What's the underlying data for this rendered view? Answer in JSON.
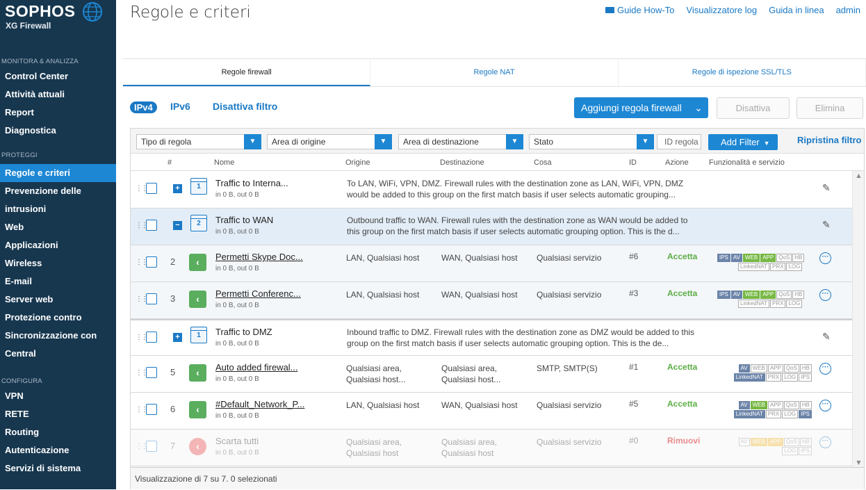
{
  "sidebar": {
    "brand": "SOPHOS",
    "product": "XG Firewall",
    "sections": [
      {
        "label": "MONITORA & ANALIZZA",
        "items": [
          "Control Center",
          "Attività attuali",
          "Report",
          "Diagnostica"
        ]
      },
      {
        "label": "PROTEGGI",
        "items": [
          "Regole e criteri",
          "Prevenzione delle",
          "intrusioni",
          "Web",
          "Applicazioni",
          "Wireless",
          "E-mail",
          "Server web",
          "Protezione contro",
          "Sincronizzazione con",
          "Central"
        ]
      },
      {
        "label": "CONFIGURA",
        "items": [
          "VPN",
          "RETE",
          "Routing",
          "Autenticazione",
          "Servizi di sistema"
        ]
      }
    ],
    "active_item": "Regole e criteri"
  },
  "header": {
    "title": "Regole e criteri",
    "links": {
      "guide": "Guide How-To",
      "log": "Visualizzatore log",
      "help": "Guida in linea",
      "user": "admin"
    }
  },
  "tabs": [
    "Regole firewall",
    "Regole NAT",
    "Regole di ispezione SSL/TLS"
  ],
  "active_tab": "Regole firewall",
  "toolbar": {
    "ipv4": "IPv4",
    "ipv6": "IPv6",
    "disable_filter": "Disattiva filtro",
    "add_rule": "Aggiungi regola firewall",
    "disable": "Disattiva",
    "delete": "Elimina"
  },
  "filters": {
    "rule_type": "Tipo di regola",
    "source_zone": "Area di origine",
    "dest_zone": "Area di destinazione",
    "status": "Stato",
    "rule_id_placeholder": "ID regola",
    "add_filter": "Add Filter",
    "reset": "Ripristina filtro"
  },
  "columns": [
    "#",
    "Nome",
    "Origine",
    "Destinazione",
    "Cosa",
    "ID",
    "Azione",
    "Funzionalità e servizio"
  ],
  "rows": [
    {
      "kind": "group",
      "number": "1",
      "name": "Traffic to Interna...",
      "traffic": "in 0 B, out 0 B",
      "description": "To LAN, WiFi, VPN, DMZ. Firewall rules with the destination zone as LAN, WiFi, VPN, DMZ would be added to this group on the first match basis if user selects automatic grouping..."
    },
    {
      "kind": "group",
      "number": "2",
      "name": "Traffic to WAN",
      "traffic": "in 0 B, out 0 B",
      "description": "Outbound traffic to WAN. Firewall rules with the destination zone as WAN would be added to this group on the first match basis if user selects automatic grouping option. This is the d..."
    },
    {
      "kind": "rule",
      "number": "2",
      "name": "Permetti Skype Doc...",
      "traffic": "in 0 B, out 0 B",
      "source": "LAN, Qualsiasi host",
      "destination": "WAN, Qualsiasi host",
      "what": "Qualsiasi servizio",
      "id": "#6",
      "action": "Accetta"
    },
    {
      "kind": "rule",
      "number": "3",
      "name": "Permetti Conferenc...",
      "traffic": "in 0 B, out 0 B",
      "source": "LAN, Qualsiasi host",
      "destination": "WAN, Qualsiasi host",
      "what": "Qualsiasi servizio",
      "id": "#3",
      "action": "Accetta"
    },
    {
      "kind": "group",
      "number": "1",
      "name": "Traffic to DMZ",
      "traffic": "in 0 B, out 0 B",
      "description": "Inbound traffic to DMZ. Firewall rules with the destination zone as DMZ would be added to this group on the first match basis if user selects automatic grouping option. This is the de..."
    },
    {
      "kind": "rule",
      "number": "5",
      "name": "Auto added firewal...",
      "traffic": "in 0 B, out 0 B",
      "source": "Qualsiasi area,",
      "source2": "Qualsiasi host...",
      "destination": "Qualsiasi area,",
      "destination2": "Qualsiasi host...",
      "what": "SMTP, SMTP(S)",
      "id": "#1",
      "action": "Accetta"
    },
    {
      "kind": "rule",
      "number": "6",
      "name": "#Default_Network_P...",
      "traffic": "in 0 B, out 0 B",
      "source": "LAN, Qualsiasi host",
      "destination": "WAN, Qualsiasi host",
      "what": "Qualsiasi servizio",
      "id": "#5",
      "action": "Accetta"
    },
    {
      "kind": "rule",
      "number": "7",
      "name": "Scarta tutti",
      "traffic": "in 0 B, out 0 B",
      "source": "Qualsiasi area,",
      "source2": "Qualsiasi host",
      "destination": "Qualsiasi area,",
      "destination2": "Qualsiasi host",
      "what": "Qualsiasi servizio",
      "id": "#0",
      "action": "Rimuovi"
    }
  ],
  "badges": {
    "ips": "IPS",
    "av": "AV",
    "web": "WEB",
    "app": "APP",
    "qos": "QoS",
    "hb": "HB",
    "linkednat": "LinkedNAT",
    "prx": "PRX",
    "log": "LOG"
  },
  "footer": "Visualizzazione di 7 su 7. 0 selezionati"
}
